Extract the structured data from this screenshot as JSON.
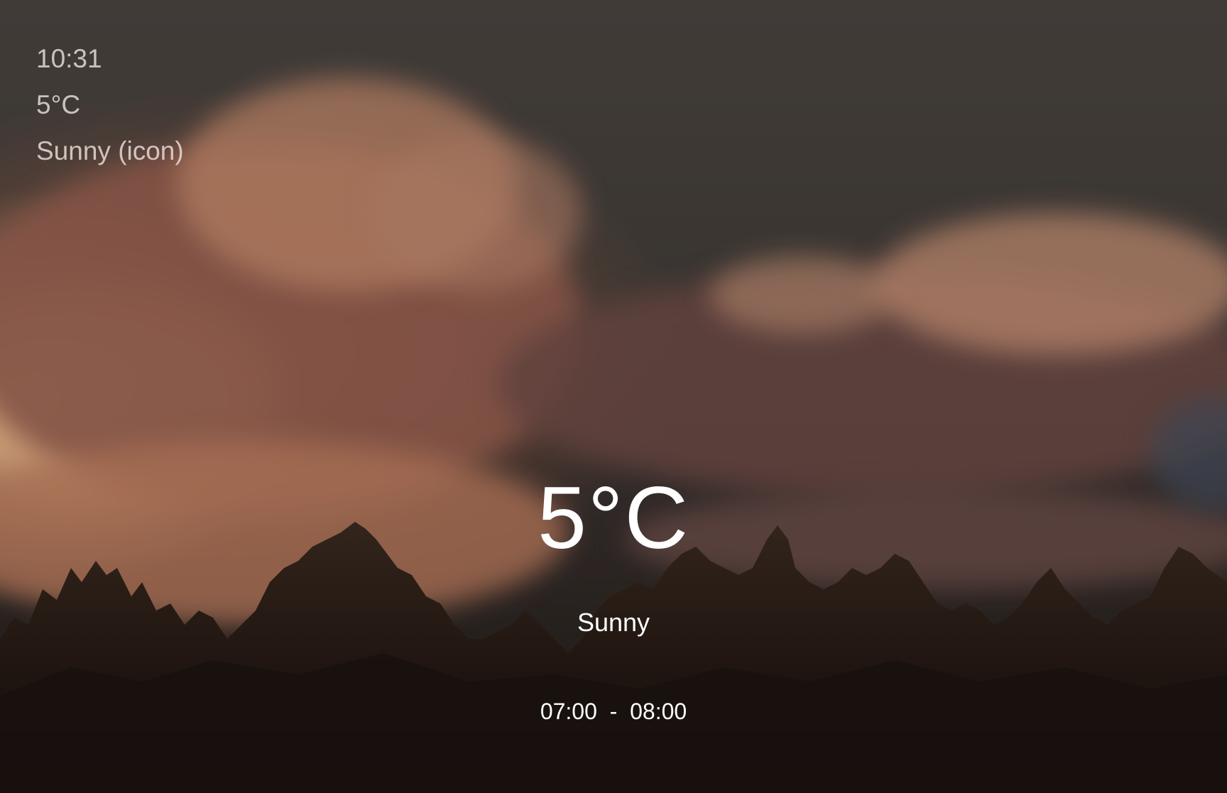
{
  "status": {
    "time": "10:31",
    "temperature": "5°C",
    "condition": "Sunny (icon)"
  },
  "main": {
    "temperature": "5°C",
    "condition": "Sunny",
    "time_range": "07:00  -  08:00"
  },
  "colors": {
    "text": "#ffffff",
    "status_text": "#ebe1dc",
    "sky_dark": "#433d39",
    "glow": "#eca878"
  }
}
